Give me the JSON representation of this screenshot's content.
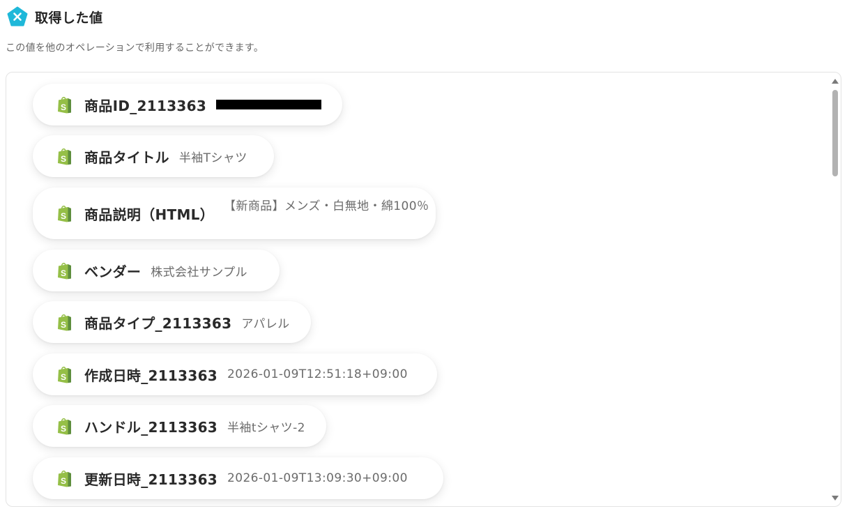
{
  "header": {
    "title": "取得した値",
    "logo_icon": "x-pentagon-logo-icon",
    "logo_color": "#1fb8d9"
  },
  "subtitle": "この値を他のオペレーションで利用することができます。",
  "fields": [
    {
      "label": "商品ID_2113363",
      "value": "",
      "redacted": true
    },
    {
      "label": "商品タイトル",
      "value": "半袖Tシャツ"
    },
    {
      "label": "商品説明（HTML）",
      "value": "【新商品】メンズ・白無地・綿100％"
    },
    {
      "label": "ベンダー",
      "value": "株式会社サンプル"
    },
    {
      "label": "商品タイプ_2113363",
      "value": "アパレル"
    },
    {
      "label": "作成日時_2113363",
      "value": "2026-01-09T12:51:18+09:00"
    },
    {
      "label": "ハンドル_2113363",
      "value": "半袖tシャツ-2"
    },
    {
      "label": "更新日時_2113363",
      "value": "2026-01-09T13:09:30+09:00"
    }
  ],
  "field_icon": "shopify-bag-icon",
  "colors": {
    "shopify_green": "#95bf47",
    "shopify_dark": "#5e8e3e"
  }
}
